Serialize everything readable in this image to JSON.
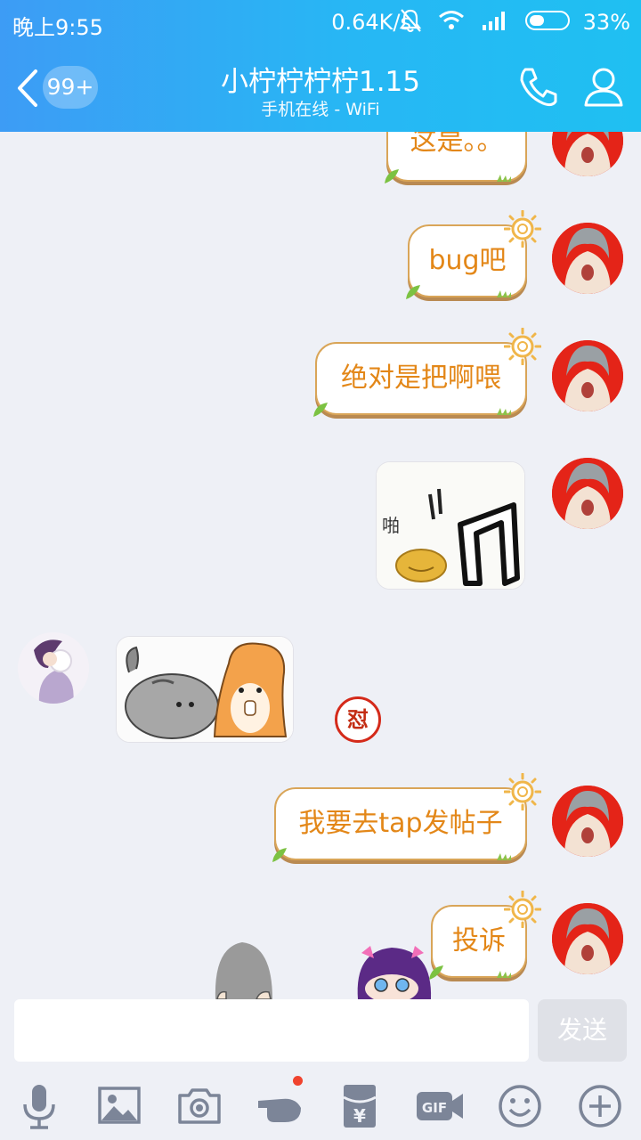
{
  "status_bar": {
    "time": "晚上9:55",
    "speed": "0.64K/s",
    "battery": "33%",
    "icons": [
      "mute-icon",
      "wifi-icon",
      "signal-icon",
      "battery-icon"
    ]
  },
  "header": {
    "back_icon": "chevron-left-icon",
    "unread_count": "99+",
    "title": "小柠柠柠柠1.15",
    "subtitle": "手机在线 - WiFi",
    "actions": [
      "phone-icon",
      "profile-icon"
    ]
  },
  "messages": [
    {
      "type": "text",
      "side": "right",
      "text": "这是。。"
    },
    {
      "type": "text",
      "side": "right",
      "text": "bug吧"
    },
    {
      "type": "text",
      "side": "right",
      "text": "绝对是把啊喂"
    },
    {
      "type": "sticker",
      "side": "right",
      "sticker_text": "啪"
    },
    {
      "type": "sticker",
      "side": "left",
      "reaction": "怼"
    },
    {
      "type": "text",
      "side": "right",
      "text": "我要去tap发帖子"
    },
    {
      "type": "text",
      "side": "right",
      "text": "投诉"
    }
  ],
  "input": {
    "value": "",
    "placeholder": "",
    "send_label": "发送"
  },
  "toolbar": {
    "items": [
      "microphone-icon",
      "image-icon",
      "camera-icon",
      "poke-icon",
      "red-packet-icon",
      "gif-icon",
      "emoji-icon",
      "plus-icon"
    ],
    "red_packet_symbol": "¥",
    "gif_label": "GIF"
  },
  "colors": {
    "header_start": "#3d9cf5",
    "header_end": "#1fc0f2",
    "bubble_text": "#e38718",
    "bubble_border": "#d9a558",
    "background": "#eef0f6",
    "avatar_bg": "#e42418"
  }
}
